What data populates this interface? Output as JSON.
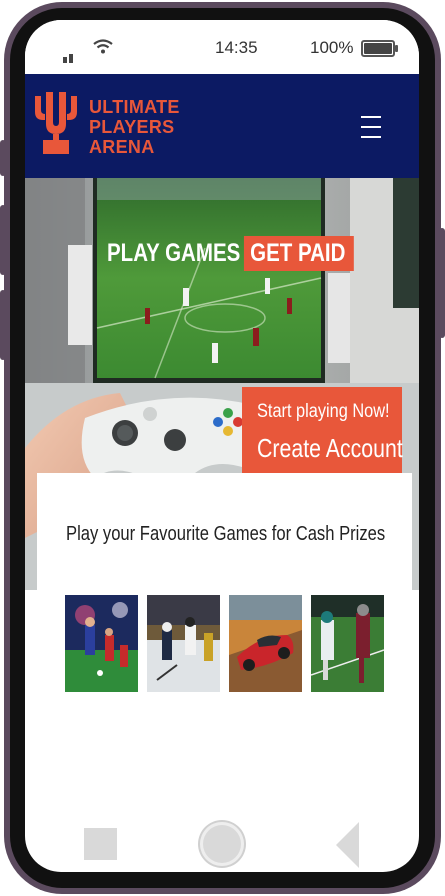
{
  "status_bar": {
    "time": "14:35",
    "battery_percent": "100%"
  },
  "header": {
    "logo_lines": [
      "ULTIMATE",
      "PLAYERS",
      "ARENA"
    ],
    "logo_mark": "U",
    "menu_icon": "hamburger-icon"
  },
  "hero": {
    "title_part1": "PLAY GAMES",
    "title_part2": "GET PAID",
    "cta_line1": "Start playing Now!",
    "cta_line2": "Create Account"
  },
  "main": {
    "tagline": "Play your Favourite Games for Cash Prizes",
    "games": [
      {
        "name": "football-game-thumbnail"
      },
      {
        "name": "hockey-game-thumbnail"
      },
      {
        "name": "racing-game-thumbnail"
      },
      {
        "name": "american-football-game-thumbnail"
      }
    ]
  },
  "colors": {
    "header_bg": "#0c1a63",
    "accent": "#e8573a",
    "phone_frame": "#5b4a5e"
  }
}
